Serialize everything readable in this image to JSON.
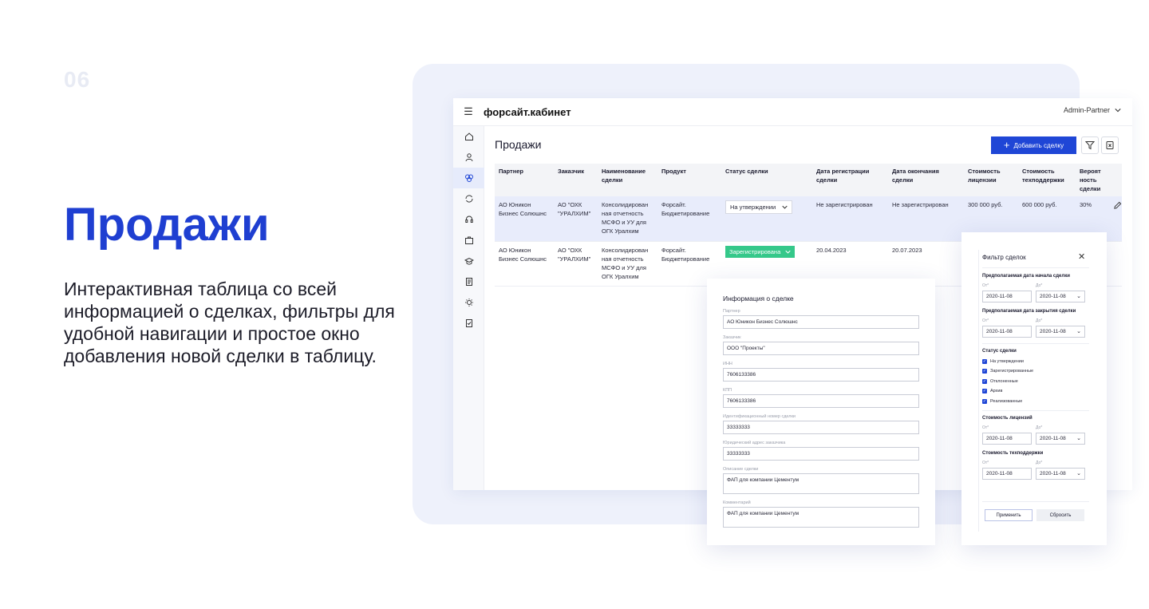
{
  "slide": {
    "number": "06",
    "title": "Продажи",
    "description": "Интерактивная таблица со всей информацией о сделках, фильтры для удобной навигации и простое окно добавления новой сделки в таблицу."
  },
  "app": {
    "brand": "форсайт.кабинет",
    "user": "Admin-Partner",
    "page_title": "Продажи",
    "add_button": "Добавить сделку",
    "sidebar_icons": [
      "home-icon",
      "user-icon",
      "deals-icon",
      "sync-icon",
      "support-icon",
      "briefcase-icon",
      "education-icon",
      "document-icon",
      "idea-icon",
      "report-icon"
    ],
    "table": {
      "headers": [
        "Партнер",
        "Заказчик",
        "Наименование сделки",
        "Продукт",
        "Статус сделки",
        "Дата регистрации сделки",
        "Дата окончания сделки",
        "Стоимость лицензии",
        "Стоимость техподдержки",
        "Вероят ность сделки"
      ],
      "rows": [
        {
          "partner": "АО Юникон Бизнес Солюшнс",
          "customer": "АО \"ОХК \"УРАЛХИМ\"",
          "deal_name": "Консолидирован ная отчетность МСФО и УУ для ОГК Уралхим",
          "product": "Форсайт. Бюджетирование",
          "status": "На утверждении",
          "reg_date": "Не зарегистрирован",
          "end_date": "Не зарегистрирован",
          "license": "300 000 руб.",
          "support": "600 000 руб.",
          "probability": "30%"
        },
        {
          "partner": "АО Юникон Бизнес Солюшнс",
          "customer": "АО \"ОХК \"УРАЛХИМ\"",
          "deal_name": "Консолидирован ная отчетность МСФО и УУ для ОГК Уралхим",
          "product": "Форсайт. Бюджетирование",
          "status": "Зарегистрирована",
          "reg_date": "20.04.2023",
          "end_date": "20.07.2023"
        }
      ]
    }
  },
  "deal_info": {
    "title": "Информация о сделке",
    "fields": [
      {
        "label": "Партнер",
        "value": "АО Юникон Бизнес Солюшнс"
      },
      {
        "label": "Заказчик",
        "value": "ООО \"Проекты\""
      },
      {
        "label": "ИНН",
        "value": "7606133386"
      },
      {
        "label": "КПП",
        "value": "7606133386"
      },
      {
        "label": "Идентификационный номер сделки",
        "value": "33333333"
      },
      {
        "label": "Юридический адрес заказчика",
        "value": "33333333"
      },
      {
        "label": "Описание сделки",
        "value": "ФАП для компании Цементум"
      },
      {
        "label": "Комментарий",
        "value": "ФАП для компании Цементум"
      }
    ]
  },
  "filter": {
    "title": "Фильтр сделок",
    "start_date": {
      "label": "Предполагаемая дата начала сделки",
      "from_label": "От*",
      "to_label": "До*",
      "from": "2020-11-08",
      "to": "2020-11-08"
    },
    "end_date": {
      "label": "Предполагаемая дата закрытия сделки",
      "from_label": "От*",
      "to_label": "До*",
      "from": "2020-11-08",
      "to": "2020-11-08"
    },
    "status": {
      "label": "Статус сделки",
      "options": [
        "На утверждении",
        "Зарегистрированные",
        "Отклоненные",
        "Архив",
        "Реализованные"
      ]
    },
    "license_cost": {
      "label": "Стоимость лицензий",
      "from_label": "От*",
      "to_label": "До*",
      "from": "2020-11-08",
      "to": "2020-11-08"
    },
    "support_cost": {
      "label": "Стоимость техподдержки",
      "from_label": "От*",
      "to_label": "До*",
      "from": "2020-11-08",
      "to": "2020-11-08"
    },
    "apply": "Применить",
    "reset": "Сбросить"
  },
  "colors": {
    "accent": "#1f3fd1",
    "button": "#1f46d6",
    "status_registered": "#35c88a",
    "selected_row": "#e8ecfb"
  }
}
